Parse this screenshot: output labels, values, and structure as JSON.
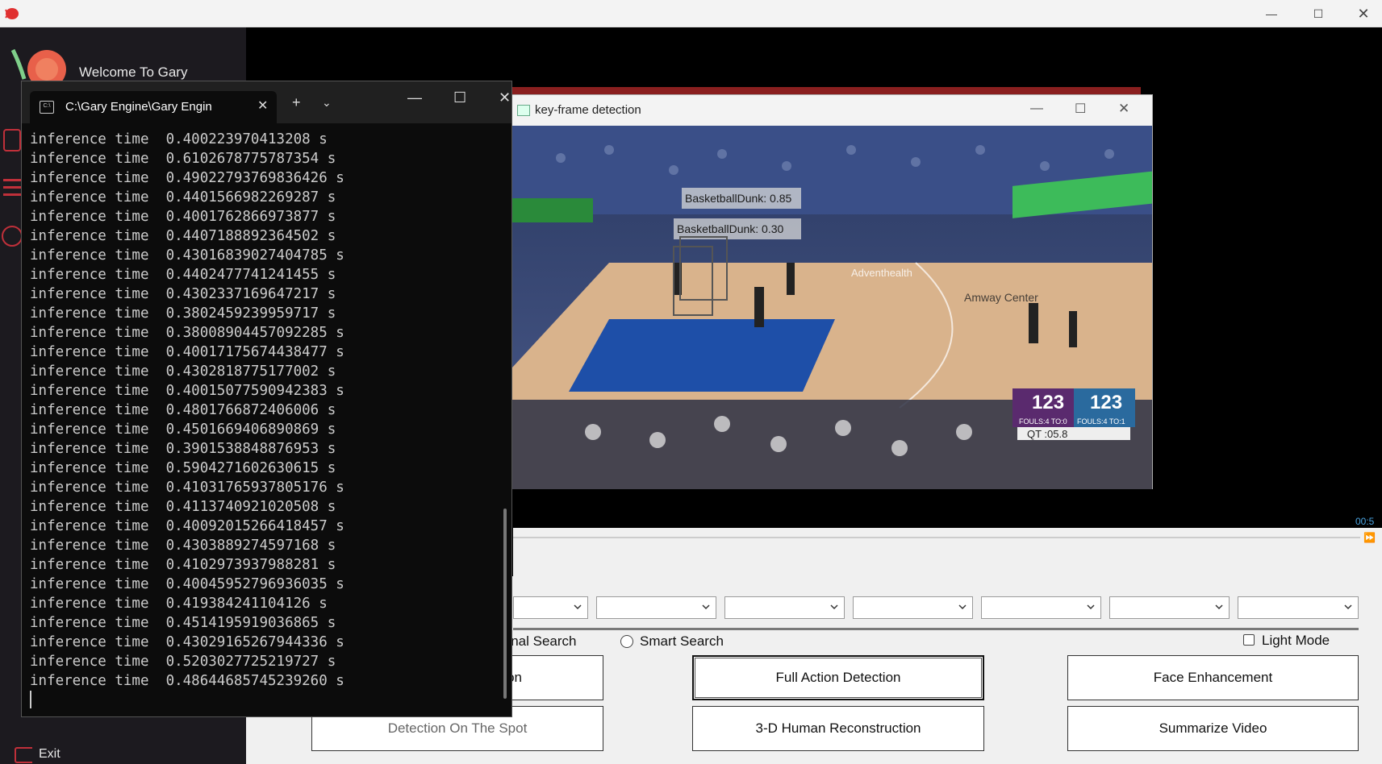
{
  "colors": {
    "titlebar_bg": "#f3f3f3",
    "sidebar_bg": "#1c1a1f",
    "terminal_bg": "#0c0c0c",
    "terminal_text": "#cccccc",
    "time_readout": "#4aa3e0",
    "brand_red": "#e03030",
    "court": "#d9b38c"
  },
  "app": {
    "logo_icon": "snail-logo-icon",
    "welcome": "Welcome To Gary",
    "exit_label": "Exit",
    "time_readout": "00:5"
  },
  "terminal": {
    "tab_title": "C:\\Gary Engine\\Gary Engin",
    "lines": [
      "inference time  0.400223970413208 s",
      "inference time  0.6102678775787354 s",
      "inference time  0.49022793769836426 s",
      "inference time  0.4401566982269287 s",
      "inference time  0.4001762866973877 s",
      "inference time  0.4407188892364502 s",
      "inference time  0.43016839027404785 s",
      "inference time  0.4402477741241455 s",
      "inference time  0.4302337169647217 s",
      "inference time  0.3802459239959717 s",
      "inference time  0.38008904457092285 s",
      "inference time  0.40017175674438477 s",
      "inference time  0.4302818775177002 s",
      "inference time  0.40015077590942383 s",
      "inference time  0.4801766872406006 s",
      "inference time  0.4501669406890869 s",
      "inference time  0.3901538848876953 s",
      "inference time  0.5904271602630615 s",
      "inference time  0.41031765937805176 s",
      "inference time  0.4113740921020508 s",
      "inference time  0.40092015266418457 s",
      "inference time  0.4303889274597168 s",
      "inference time  0.4102973937988281 s",
      "inference time  0.40045952796936035 s",
      "inference time  0.419384241104126 s",
      "inference time  0.4514195919036865 s",
      "inference time  0.43029165267944336 s",
      "inference time  0.5203027725219727 s",
      "inference time  0.48644685745239260 s"
    ]
  },
  "keyframe": {
    "title": "key-frame detection",
    "detections": [
      {
        "label": "BasketballDunk: 0.85"
      },
      {
        "label": "BasketballDunk: 0.30"
      }
    ],
    "scoreboard": {
      "home_score": "123",
      "away_score": "123",
      "fouls_left": "FOULS:4  TO:0",
      "fouls_right": "FOULS:4  TO:1",
      "clock": "QT  :05.8"
    },
    "court_texts": [
      "Adventhealth",
      "Amway Center"
    ]
  },
  "controls": {
    "dropdown_values": [
      "",
      "",
      "",
      "",
      "",
      "",
      ""
    ],
    "radio_original": "ginal Search",
    "radio_smart": "Smart Search",
    "light_mode": "Light Mode",
    "buttons": {
      "partial_top": "on",
      "full_action": "Full Action Detection",
      "face_enhance": "Face Enhancement",
      "spot_detect": "Detection On The Spot",
      "human_3d": "3-D Human Reconstruction",
      "summarize": "Summarize Video"
    }
  }
}
